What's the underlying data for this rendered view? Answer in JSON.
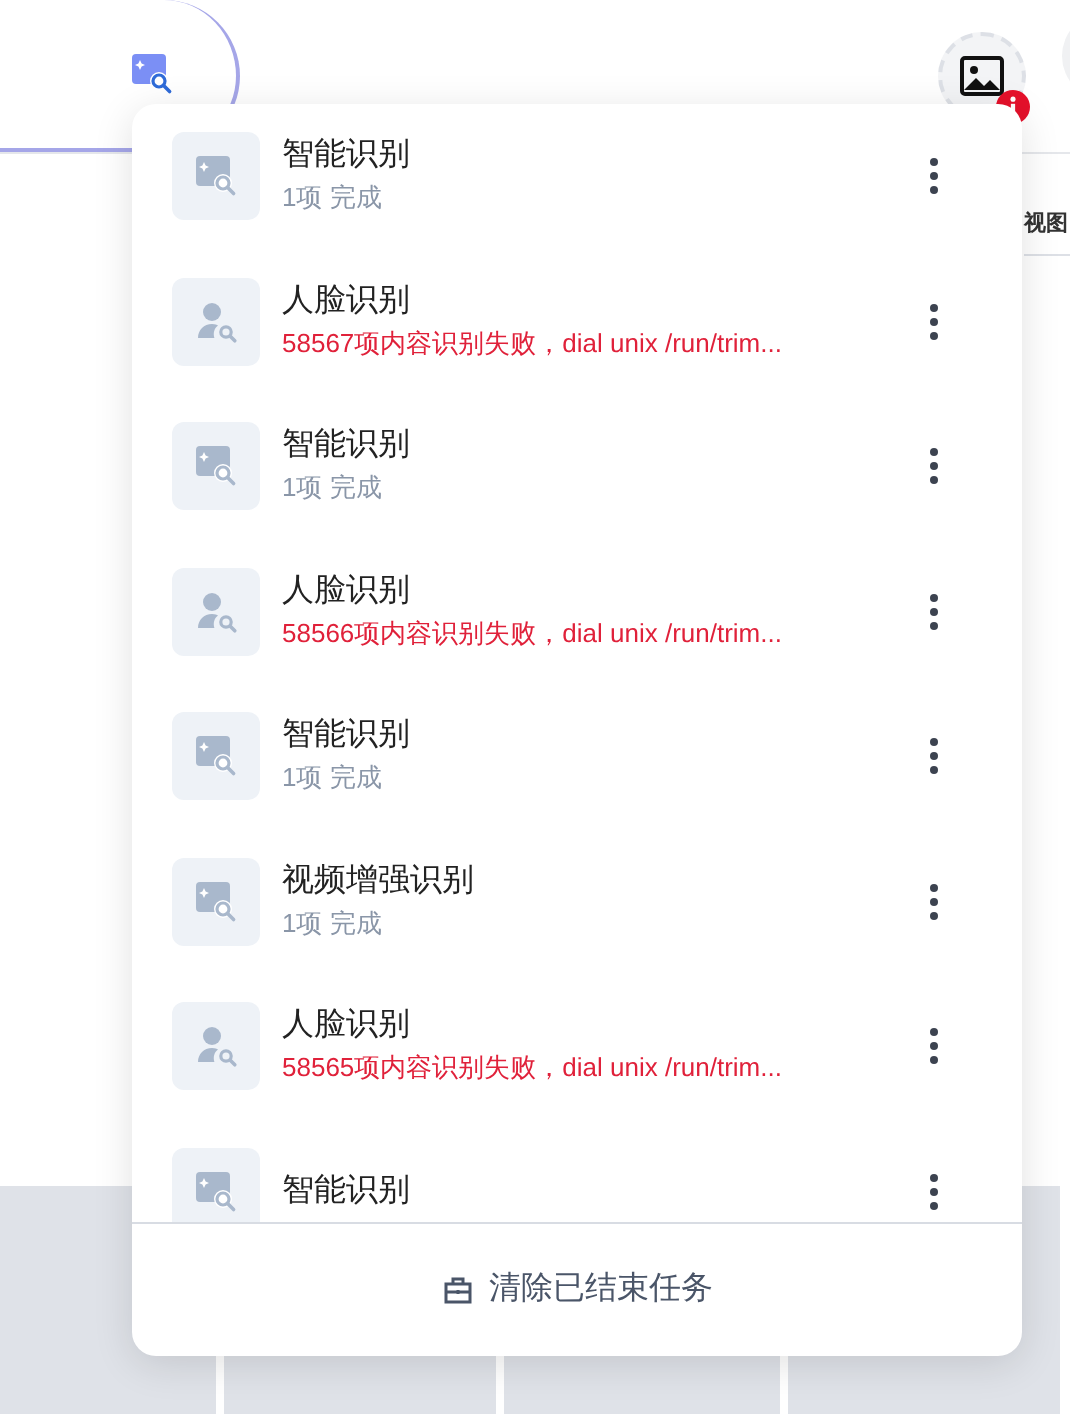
{
  "side_label": "视图",
  "tasks": [
    {
      "kind": "smart",
      "title": "智能识别",
      "failed": false,
      "subtitle": "1项 完成"
    },
    {
      "kind": "face",
      "title": "人脸识别",
      "failed": true,
      "subtitle": "58567项内容识别失败，dial unix /run/trim..."
    },
    {
      "kind": "smart",
      "title": "智能识别",
      "failed": false,
      "subtitle": "1项 完成"
    },
    {
      "kind": "face",
      "title": "人脸识别",
      "failed": true,
      "subtitle": "58566项内容识别失败，dial unix /run/trim..."
    },
    {
      "kind": "smart",
      "title": "智能识别",
      "failed": false,
      "subtitle": "1项 完成"
    },
    {
      "kind": "smart",
      "title": "视频增强识别",
      "failed": false,
      "subtitle": "1项 完成"
    },
    {
      "kind": "face",
      "title": "人脸识别",
      "failed": true,
      "subtitle": "58565项内容识别失败，dial unix /run/trim..."
    },
    {
      "kind": "smart",
      "title": "智能识别"
    }
  ],
  "footer_button": "清除已结束任务"
}
